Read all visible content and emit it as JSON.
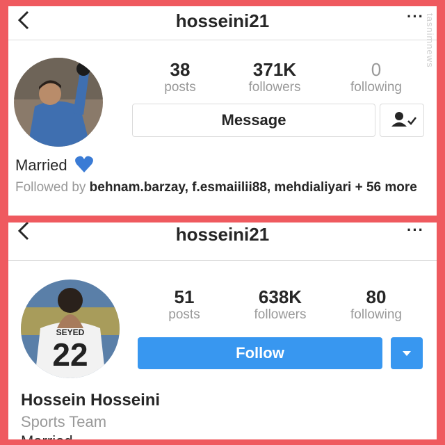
{
  "profile1": {
    "username": "hosseini21",
    "more_label": "···",
    "watermark": "tasnimnews",
    "stats": [
      {
        "value": "38",
        "label": "posts"
      },
      {
        "value": "371K",
        "label": "followers"
      },
      {
        "value": "0",
        "label": "following"
      }
    ],
    "message_label": "Message",
    "bio": "Married",
    "followed_prefix": "Followed by ",
    "followed_names": "behnam.barzay, f.esmaiilii88, mehdialiyari",
    "followed_more": " + 56 more"
  },
  "profile2": {
    "username": "hosseini21",
    "more_label": "···",
    "stats": [
      {
        "value": "51",
        "label": "posts"
      },
      {
        "value": "638K",
        "label": "followers"
      },
      {
        "value": "80",
        "label": "following"
      }
    ],
    "follow_label": "Follow",
    "full_name": "Hossein Hosseini",
    "category": "Sports Team",
    "bio": "Married",
    "jersey_name": "SEYED",
    "jersey_number": "22"
  },
  "colors": {
    "border": "#ef5a5f",
    "follow": "#3897f0",
    "heart": "#3a7bd5"
  }
}
